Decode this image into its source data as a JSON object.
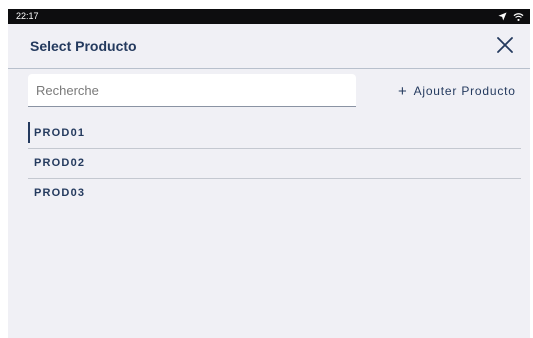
{
  "status_bar": {
    "time": "22:17",
    "icons": [
      "location-arrow-icon",
      "wifi-icon"
    ]
  },
  "dialog": {
    "title": "Select Producto",
    "close_icon": "close-icon"
  },
  "search": {
    "placeholder": "Recherche",
    "value": ""
  },
  "add_button": {
    "icon": "plus-icon",
    "label": "Ajouter Producto"
  },
  "products": [
    {
      "label": "PROD01",
      "selected": true
    },
    {
      "label": "PROD02",
      "selected": false
    },
    {
      "label": "PROD03",
      "selected": false
    }
  ],
  "colors": {
    "accent": "#243a5e",
    "background": "#f0f0f5",
    "status_bar": "#0d0d0f"
  }
}
